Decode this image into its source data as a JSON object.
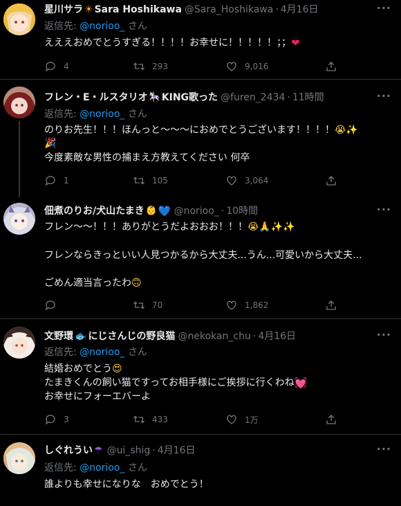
{
  "tweets": [
    {
      "name": "星川サラ",
      "name_suffix": "Sara Hoshikawa",
      "handle": "@Sara_Hoshikawa",
      "time": "4月16日",
      "reply_prefix": "返信先:",
      "reply_mention": "@norioo_",
      "reply_suffix": "さん",
      "lines": [
        "えええおめでとうすぎる！！！！お幸せに！！！！！；；"
      ],
      "replies": "4",
      "retweets": "293",
      "likes": "9,016"
    },
    {
      "name": "フレン・E・ルスタリオ",
      "name_suffix": "KING歌った",
      "handle": "@furen_2434",
      "time": "11時間",
      "reply_prefix": "返信先:",
      "reply_mention": "@norioo_",
      "reply_suffix": "さん",
      "lines": [
        "のりお先生！！！ほんっと〜〜〜におめでとうございます！！！！",
        "",
        "今度素敵な男性の捕まえ方教えてください 何卒"
      ],
      "replies": "1",
      "retweets": "105",
      "likes": "3,064"
    },
    {
      "name": "佃煮のりお/犬山たまき",
      "name_suffix": "",
      "handle": "@norioo_",
      "time": "10時間",
      "lines": [
        "フレン〜〜！！！ありがとうだよおおお！！！",
        "フレンならきっといい人見つかるから大丈夫...うん...可愛いから大丈夫...",
        "ごめん適当言ったわ"
      ],
      "replies": "",
      "retweets": "70",
      "likes": "1,862"
    },
    {
      "name": "文野環",
      "name_suffix": "にじさんじの野良猫",
      "handle": "@nekokan_chu",
      "time": "4月16日",
      "reply_prefix": "返信先:",
      "reply_mention": "@norioo_",
      "reply_suffix": "さん",
      "lines": [
        "結婚おめでとう",
        "たまきくんの飼い猫ですってお相手様にご挨拶に行くわね",
        "お幸せにフォーエバーよ"
      ],
      "replies": "3",
      "retweets": "433",
      "likes": "1万"
    },
    {
      "name": "しぐれうい",
      "name_suffix": "",
      "handle": "@ui_shig",
      "time": "4月16日",
      "reply_prefix": "返信先:",
      "reply_mention": "@norioo_",
      "reply_suffix": "さん",
      "lines": [
        "誰よりも幸せになりな　おめでとう！"
      ],
      "replies": "",
      "retweets": "",
      "likes": ""
    }
  ],
  "colors": {
    "background": "#000000",
    "name": "#e7e9ea",
    "muted": "#71767b",
    "mention": "#1d9bf0",
    "divider": "#2f3336"
  },
  "icons": [
    "reply-icon",
    "retweet-icon",
    "like-icon",
    "share-icon",
    "more-icon"
  ]
}
